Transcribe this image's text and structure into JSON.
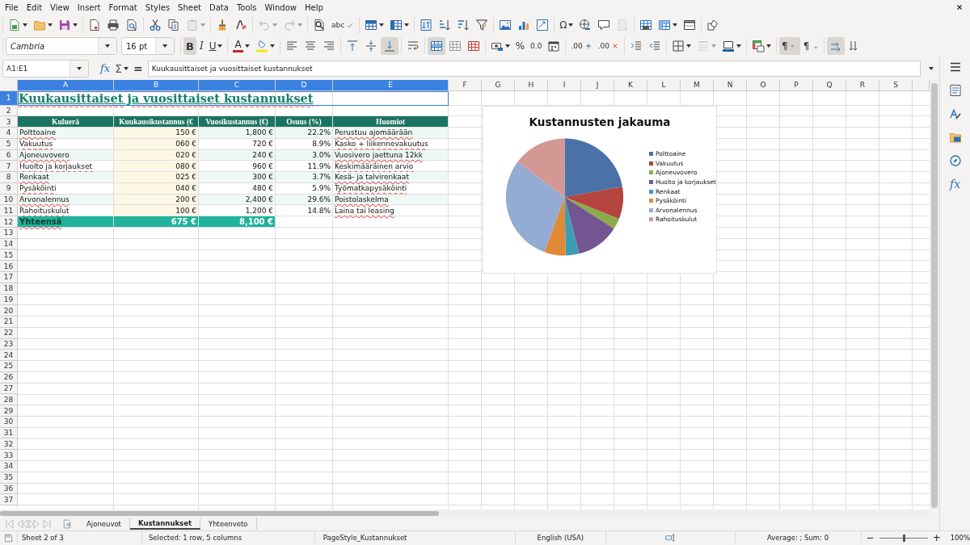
{
  "menu": {
    "items": [
      "File",
      "Edit",
      "View",
      "Insert",
      "Format",
      "Styles",
      "Sheet",
      "Data",
      "Tools",
      "Window",
      "Help"
    ]
  },
  "toolbar_1": [
    [
      {
        "kind": "new",
        "dropdown": true,
        "disabled": false,
        "pressed": false
      },
      {
        "kind": "open",
        "dropdown": true,
        "disabled": false,
        "pressed": false
      },
      {
        "kind": "save",
        "dropdown": true,
        "disabled": false,
        "pressed": false
      }
    ],
    [
      {
        "kind": "pdf",
        "dropdown": false,
        "disabled": false,
        "pressed": false
      },
      {
        "kind": "print",
        "dropdown": false,
        "disabled": false,
        "pressed": false
      },
      {
        "kind": "preview",
        "dropdown": false,
        "disabled": false,
        "pressed": false
      }
    ],
    [
      {
        "kind": "cut",
        "dropdown": false,
        "disabled": false,
        "pressed": false
      },
      {
        "kind": "copy",
        "dropdown": false,
        "disabled": false,
        "pressed": false
      },
      {
        "kind": "paste",
        "dropdown": true,
        "disabled": true,
        "pressed": false
      }
    ],
    [
      {
        "kind": "clone",
        "dropdown": false,
        "disabled": false,
        "pressed": false
      },
      {
        "kind": "clear",
        "dropdown": false,
        "disabled": false,
        "pressed": false
      }
    ],
    [
      {
        "kind": "undo",
        "dropdown": true,
        "disabled": true,
        "pressed": false
      },
      {
        "kind": "redo",
        "dropdown": true,
        "disabled": true,
        "pressed": false
      }
    ],
    [
      {
        "kind": "find",
        "dropdown": false,
        "disabled": false,
        "pressed": false
      },
      {
        "kind": "spell",
        "label": "abc",
        "dropdown": false,
        "disabled": false,
        "pressed": false
      }
    ],
    [
      {
        "kind": "rows",
        "dropdown": true,
        "disabled": false,
        "pressed": false
      },
      {
        "kind": "cols",
        "dropdown": true,
        "disabled": false,
        "pressed": false
      }
    ],
    [
      {
        "kind": "sort",
        "dropdown": false,
        "disabled": false,
        "pressed": false
      },
      {
        "kind": "sortasc",
        "dropdown": false,
        "disabled": false,
        "pressed": false
      },
      {
        "kind": "sortdesc",
        "dropdown": false,
        "disabled": false,
        "pressed": false
      },
      {
        "kind": "filter",
        "dropdown": false,
        "disabled": false,
        "pressed": false
      }
    ],
    [
      {
        "kind": "image",
        "dropdown": false,
        "disabled": false,
        "pressed": false
      },
      {
        "kind": "chart",
        "dropdown": false,
        "disabled": false,
        "pressed": false
      },
      {
        "kind": "pivot",
        "dropdown": false,
        "disabled": false,
        "pressed": false
      }
    ],
    [
      {
        "kind": "special",
        "label": "Ω",
        "dropdown": true,
        "disabled": false,
        "pressed": false
      },
      {
        "kind": "link",
        "dropdown": false,
        "disabled": false,
        "pressed": false
      },
      {
        "kind": "comment",
        "dropdown": false,
        "disabled": false,
        "pressed": false
      },
      {
        "kind": "headerfooter",
        "dropdown": false,
        "disabled": true,
        "pressed": false
      }
    ],
    [
      {
        "kind": "printarea",
        "dropdown": false,
        "disabled": false,
        "pressed": false
      },
      {
        "kind": "freeze",
        "dropdown": true,
        "disabled": false,
        "pressed": false
      },
      {
        "kind": "split",
        "dropdown": false,
        "disabled": false,
        "pressed": false
      }
    ],
    [
      {
        "kind": "draw",
        "dropdown": false,
        "disabled": false,
        "pressed": false
      }
    ]
  ],
  "toolbar_2": [
    [
      {
        "kind": "fontname",
        "value": "Cambria"
      },
      {
        "kind": "fontsize",
        "value": "16 pt"
      }
    ],
    [
      {
        "kind": "bold",
        "label": "B",
        "dropdown": false,
        "disabled": false,
        "pressed": true
      },
      {
        "kind": "italic",
        "label": "I",
        "dropdown": false,
        "disabled": false,
        "pressed": false
      },
      {
        "kind": "underline",
        "label": "U",
        "dropdown": true,
        "disabled": false,
        "pressed": false
      }
    ],
    [
      {
        "kind": "fontcolor",
        "label": "A",
        "dropdown": true,
        "disabled": false,
        "pressed": false
      },
      {
        "kind": "highlight",
        "dropdown": true,
        "disabled": false,
        "pressed": false
      }
    ],
    [
      {
        "kind": "alignleft",
        "dropdown": false,
        "disabled": false,
        "pressed": false
      },
      {
        "kind": "aligncenter",
        "dropdown": false,
        "disabled": false,
        "pressed": false
      },
      {
        "kind": "alignright",
        "dropdown": false,
        "disabled": false,
        "pressed": false
      }
    ],
    [
      {
        "kind": "aligntop",
        "dropdown": false,
        "disabled": false,
        "pressed": false
      },
      {
        "kind": "alignmiddle",
        "dropdown": false,
        "disabled": false,
        "pressed": false
      },
      {
        "kind": "alignbottom",
        "dropdown": false,
        "disabled": false,
        "pressed": true
      }
    ],
    [
      {
        "kind": "wrap",
        "dropdown": false,
        "disabled": false,
        "pressed": false
      }
    ],
    [
      {
        "kind": "mergecenter",
        "dropdown": false,
        "disabled": false,
        "pressed": true
      },
      {
        "kind": "merge",
        "dropdown": false,
        "disabled": false,
        "pressed": false
      },
      {
        "kind": "unmerge",
        "dropdown": false,
        "disabled": false,
        "pressed": false
      }
    ],
    [
      {
        "kind": "currency",
        "dropdown": true,
        "disabled": false,
        "pressed": false
      },
      {
        "kind": "percent",
        "label": "%",
        "dropdown": false,
        "disabled": false,
        "pressed": false
      },
      {
        "kind": "number",
        "label": "0.0",
        "dropdown": false,
        "disabled": false,
        "pressed": false
      },
      {
        "kind": "date",
        "dropdown": false,
        "disabled": false,
        "pressed": false
      }
    ],
    [
      {
        "kind": "adddecimal",
        "label": ".00",
        "dropdown": false,
        "disabled": false,
        "pressed": false
      },
      {
        "kind": "deldecimal",
        "label": ".00",
        "dropdown": false,
        "disabled": false,
        "pressed": false
      }
    ],
    [
      {
        "kind": "indent",
        "dropdown": false,
        "disabled": false,
        "pressed": false
      },
      {
        "kind": "outdent",
        "dropdown": false,
        "disabled": false,
        "pressed": false
      }
    ],
    [
      {
        "kind": "borders",
        "dropdown": true,
        "disabled": false,
        "pressed": false
      },
      {
        "kind": "borderstyle",
        "dropdown": true,
        "disabled": true,
        "pressed": false
      },
      {
        "kind": "bordercolor",
        "dropdown": true,
        "disabled": false,
        "pressed": false
      }
    ],
    [
      {
        "kind": "conditional",
        "dropdown": true,
        "disabled": false,
        "pressed": false
      }
    ],
    [
      {
        "kind": "ltr",
        "label": "¶",
        "dropdown": false,
        "disabled": false,
        "pressed": true
      },
      {
        "kind": "rtl",
        "label": "¶",
        "dropdown": false,
        "disabled": false,
        "pressed": false
      }
    ],
    [
      {
        "kind": "textltr",
        "dropdown": false,
        "disabled": false,
        "pressed": true
      },
      {
        "kind": "vertical",
        "dropdown": false,
        "disabled": false,
        "pressed": false
      }
    ]
  ],
  "formula_bar": {
    "name_box": "A1:E1",
    "function_wizard": "fx",
    "sum": "Σ",
    "equals": "=",
    "content": "Kuukausittaiset ja vuosittaiset kustannukset"
  },
  "sheet": {
    "columns": [
      {
        "label": "A",
        "selected": true
      },
      {
        "label": "B",
        "selected": true
      },
      {
        "label": "C",
        "selected": true
      },
      {
        "label": "D",
        "selected": true
      },
      {
        "label": "E",
        "selected": true
      },
      {
        "label": "F",
        "selected": false
      },
      {
        "label": "G",
        "selected": false
      },
      {
        "label": "H",
        "selected": false
      },
      {
        "label": "I",
        "selected": false
      },
      {
        "label": "J",
        "selected": false
      },
      {
        "label": "K",
        "selected": false
      },
      {
        "label": "L",
        "selected": false
      },
      {
        "label": "M",
        "selected": false
      },
      {
        "label": "N",
        "selected": false
      },
      {
        "label": "O",
        "selected": false
      },
      {
        "label": "P",
        "selected": false
      },
      {
        "label": "Q",
        "selected": false
      },
      {
        "label": "R",
        "selected": false
      },
      {
        "label": "S",
        "selected": false
      }
    ],
    "rows": [
      {
        "label": "1",
        "selected": true
      },
      {
        "label": "2",
        "selected": false
      },
      {
        "label": "3",
        "selected": false
      },
      {
        "label": "4",
        "selected": false
      },
      {
        "label": "5",
        "selected": false
      },
      {
        "label": "6",
        "selected": false
      },
      {
        "label": "7",
        "selected": false
      },
      {
        "label": "8",
        "selected": false
      },
      {
        "label": "9",
        "selected": false
      },
      {
        "label": "10",
        "selected": false
      },
      {
        "label": "11",
        "selected": false
      },
      {
        "label": "12",
        "selected": false
      },
      {
        "label": "13",
        "selected": false
      },
      {
        "label": "14",
        "selected": false
      },
      {
        "label": "15",
        "selected": false
      },
      {
        "label": "16",
        "selected": false
      },
      {
        "label": "17",
        "selected": false
      },
      {
        "label": "18",
        "selected": false
      },
      {
        "label": "19",
        "selected": false
      },
      {
        "label": "20",
        "selected": false
      },
      {
        "label": "21",
        "selected": false
      },
      {
        "label": "22",
        "selected": false
      },
      {
        "label": "23",
        "selected": false
      },
      {
        "label": "24",
        "selected": false
      },
      {
        "label": "25",
        "selected": false
      },
      {
        "label": "26",
        "selected": false
      },
      {
        "label": "27",
        "selected": false
      },
      {
        "label": "28",
        "selected": false
      },
      {
        "label": "29",
        "selected": false
      },
      {
        "label": "30",
        "selected": false
      },
      {
        "label": "31",
        "selected": false
      },
      {
        "label": "32",
        "selected": false
      },
      {
        "label": "33",
        "selected": false
      },
      {
        "label": "34",
        "selected": false
      },
      {
        "label": "35",
        "selected": false
      },
      {
        "label": "36",
        "selected": false
      },
      {
        "label": "37",
        "selected": false
      }
    ],
    "title": {
      "text": "Kuukausittaiset ja vuosittaiset kustannukset",
      "misspelled": true,
      "selected": true
    },
    "table": {
      "header": [
        "Kuluerä",
        "Kuukausikustannus (€",
        "Vuosikustannus (€)",
        "Osuus (%)",
        "Huomiot"
      ],
      "rows": [
        {
          "item": {
            "text": "Polttoaine",
            "misspelled": true
          },
          "monthly": "150 €",
          "annual": "1,800 €",
          "share": "22.2%",
          "note": {
            "text": "Perustuu ajomäärään",
            "misspelled": true
          }
        },
        {
          "item": {
            "text": "Vakuutus",
            "misspelled": true
          },
          "monthly": "060 €",
          "annual": "720 €",
          "share": "8.9%",
          "note": {
            "text": "Kasko + liikennevakuutus",
            "misspelled": true
          }
        },
        {
          "item": {
            "text": "Ajoneuvovero",
            "misspelled": true
          },
          "monthly": "020 €",
          "annual": "240 €",
          "share": "3.0%",
          "note": {
            "text": "Vuosivero jaettuna 12kk",
            "misspelled": true
          }
        },
        {
          "item": {
            "text": "Huolto ja korjaukset",
            "misspelled": true
          },
          "monthly": "080 €",
          "annual": "960 €",
          "share": "11.9%",
          "note": {
            "text": "Keskimääräinen arvio",
            "misspelled": true
          }
        },
        {
          "item": {
            "text": "Renkaat",
            "misspelled": true
          },
          "monthly": "025 €",
          "annual": "300 €",
          "share": "3.7%",
          "note": {
            "text": "Kesä- ja talvirenkaat",
            "misspelled": true
          }
        },
        {
          "item": {
            "text": "Pysäköinti",
            "misspelled": true
          },
          "monthly": "040 €",
          "annual": "480 €",
          "share": "5.9%",
          "note": {
            "text": "Työmatkapysäköinti",
            "misspelled": true
          }
        },
        {
          "item": {
            "text": "Arvonalennus",
            "misspelled": true
          },
          "monthly": "200 €",
          "annual": "2,400 €",
          "share": "29.6%",
          "note": {
            "text": "Poistolaskelma",
            "misspelled": true
          }
        },
        {
          "item": {
            "text": "Rahoituskulut",
            "misspelled": true
          },
          "monthly": "100 €",
          "annual": "1,200 €",
          "share": "14.8%",
          "note": {
            "text": "Laina tai leasing",
            "misspelled": true
          }
        }
      ],
      "total": {
        "label": {
          "text": "Yhteensä",
          "misspelled": true
        },
        "monthly": "675 €",
        "annual": "8,100 €"
      }
    },
    "chart": {
      "chart_data": {
        "type": "pie",
        "title": "Kustannusten jakauma",
        "categories": [
          "Polttoaine",
          "Vakuutus",
          "Ajoneuvovero",
          "Huolto ja korjaukset",
          "Renkaat",
          "Pysäköinti",
          "Arvonalennus",
          "Rahoituskulut"
        ],
        "values": [
          22.2,
          8.9,
          3.0,
          11.9,
          3.7,
          5.9,
          29.6,
          14.8
        ],
        "legend": "right",
        "colors": [
          "#4a72a8",
          "#b5443f",
          "#8bab4a",
          "#735592",
          "#3d9db5",
          "#e08a38",
          "#94abd3",
          "#d49894"
        ]
      }
    }
  },
  "sheet_tabs": {
    "navigation": {
      "disabled": true
    },
    "tabs": [
      {
        "label": "Ajoneuvot",
        "selected": false
      },
      {
        "label": "Kustannukset",
        "selected": true
      },
      {
        "label": "Yhteenveto",
        "selected": false
      }
    ]
  },
  "status_bar": {
    "sheet": "Sheet 2 of 3",
    "selection": "Selected: 1 row, 5 columns",
    "page_style": "PageStyle_Kustannukset",
    "language": "English (USA)",
    "summary": "Average: ; Sum: 0",
    "zoom": {
      "level": 0.5,
      "minus": "−",
      "plus": "+",
      "value": "100%"
    }
  },
  "sidebar": {
    "functions": "fx"
  }
}
